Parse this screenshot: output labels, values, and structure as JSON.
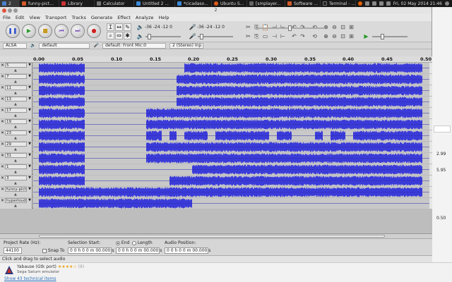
{
  "taskbar": {
    "items": [
      {
        "label": "2",
        "color": "#4a7fc9"
      },
      {
        "label": "funny-pict...",
        "color": "#d05a2a"
      },
      {
        "label": "Library",
        "color": "#c33"
      },
      {
        "label": "Calculator",
        "color": "#777"
      },
      {
        "label": "Untitled 2 ...",
        "color": "#3b8ad8"
      },
      {
        "label": "*cicadaso...",
        "color": "#3b8ad8"
      },
      {
        "label": "Ubuntu S...",
        "color": "#e05a1b"
      },
      {
        "label": "[smplayer...",
        "color": "#666"
      },
      {
        "label": "Software ...",
        "color": "#d05a2a"
      },
      {
        "label": "Terminal - ...",
        "color": "#222"
      }
    ],
    "clock": "Fri, 02 May 2014 21:46"
  },
  "window": {
    "title": "2",
    "menu": [
      "File",
      "Edit",
      "View",
      "Transport",
      "Tracks",
      "Generate",
      "Effect",
      "Analyze",
      "Help"
    ]
  },
  "meters": {
    "playback_label": "-36 -24 -12 0",
    "record_label": "-36 -24 -12 0"
  },
  "devices": {
    "host": "ALSA",
    "output": "default",
    "input": "default: Front Mic:0",
    "channels": "2 (Stereo) Inp"
  },
  "ruler": {
    "ticks": [
      "0.00",
      "0.05",
      "0.10",
      "0.15",
      "0.20",
      "0.25",
      "0.30",
      "0.35",
      "0.40",
      "0.45",
      "0.50"
    ]
  },
  "tracks": [
    {
      "name": "5"
    },
    {
      "name": "7"
    },
    {
      "name": "11"
    },
    {
      "name": "13"
    },
    {
      "name": "17"
    },
    {
      "name": "19"
    },
    {
      "name": "23"
    },
    {
      "name": "29"
    },
    {
      "name": "31"
    },
    {
      "name": "1"
    },
    {
      "name": "3"
    },
    {
      "name": "funny-pictur"
    },
    {
      "name": "hyperloud"
    }
  ],
  "selection": {
    "project_rate_label": "Project Rate (Hz):",
    "project_rate": "44100",
    "snap_label": "Snap To",
    "selection_start_label": "Selection Start:",
    "end_label": "End",
    "length_label": "Length",
    "start_value": "0 0 h 0 0 m 00.000 s",
    "end_value": "0 0 h 0 0 m 00.000 s",
    "audio_position_label": "Audio Position:",
    "audio_position_value": "0 0 h 0 0 m 00.000 s"
  },
  "status": "Click and drag to select audio",
  "software_center": {
    "app_name": "Yabause (Gtk port)",
    "rating_stars": "★★★★☆",
    "rating_count": "(9)",
    "description": "Sega Saturn emulator",
    "tech_items_link": "Show 43 technical items"
  },
  "background_app": {
    "values": [
      "2.99",
      "5.95",
      "0.50"
    ]
  },
  "colors": {
    "waveform": "#3b3bd8",
    "waveform_bg": "#c8c8c8"
  }
}
